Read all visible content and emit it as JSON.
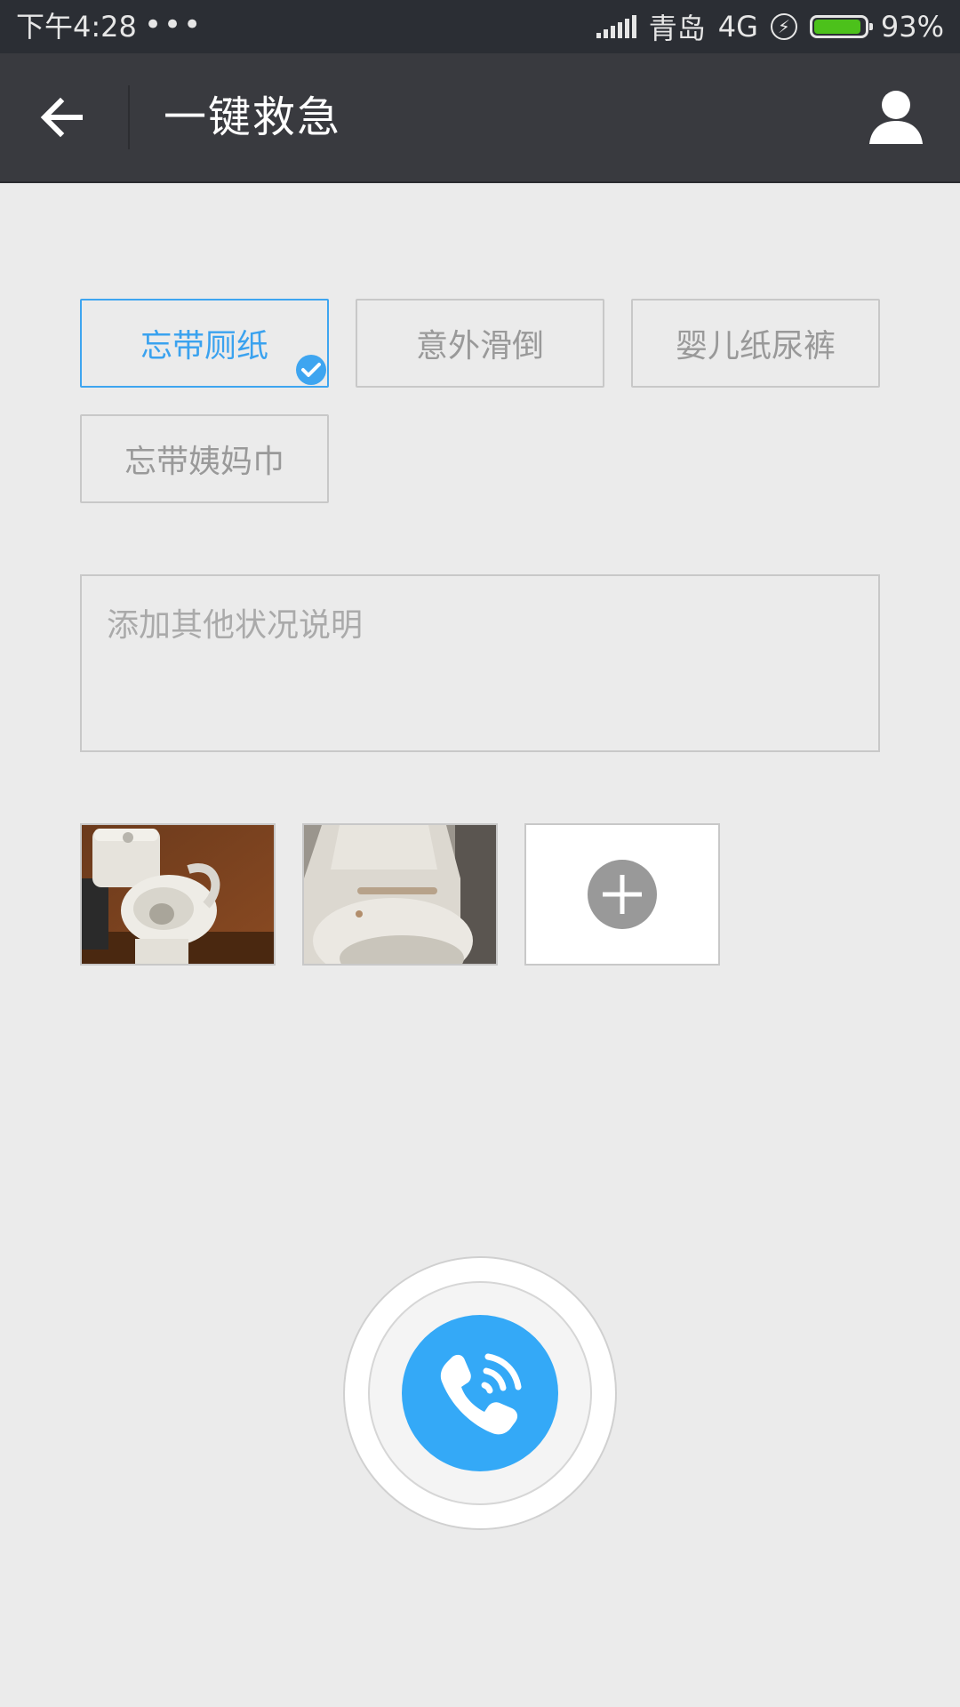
{
  "status_bar": {
    "time": "下午4:28",
    "dots": "•••",
    "carrier": "青岛",
    "network": "4G",
    "battery": "93%",
    "battery_level": 0.93,
    "battery_color": "#4cc11b"
  },
  "nav": {
    "title": "一键救急",
    "back_icon": "arrow-left-icon",
    "profile_icon": "user-icon"
  },
  "tags": [
    {
      "label": "忘带厕纸",
      "selected": true
    },
    {
      "label": "意外滑倒",
      "selected": false
    },
    {
      "label": "婴儿纸尿裤",
      "selected": false
    },
    {
      "label": "忘带姨妈巾",
      "selected": false
    }
  ],
  "note": {
    "placeholder": "添加其他状况说明",
    "value": ""
  },
  "photos": {
    "count": 2,
    "add_icon": "plus-icon"
  },
  "call": {
    "icon": "phone-call-icon",
    "color": "#34a9f7"
  },
  "accent_color": "#3aa2ef"
}
